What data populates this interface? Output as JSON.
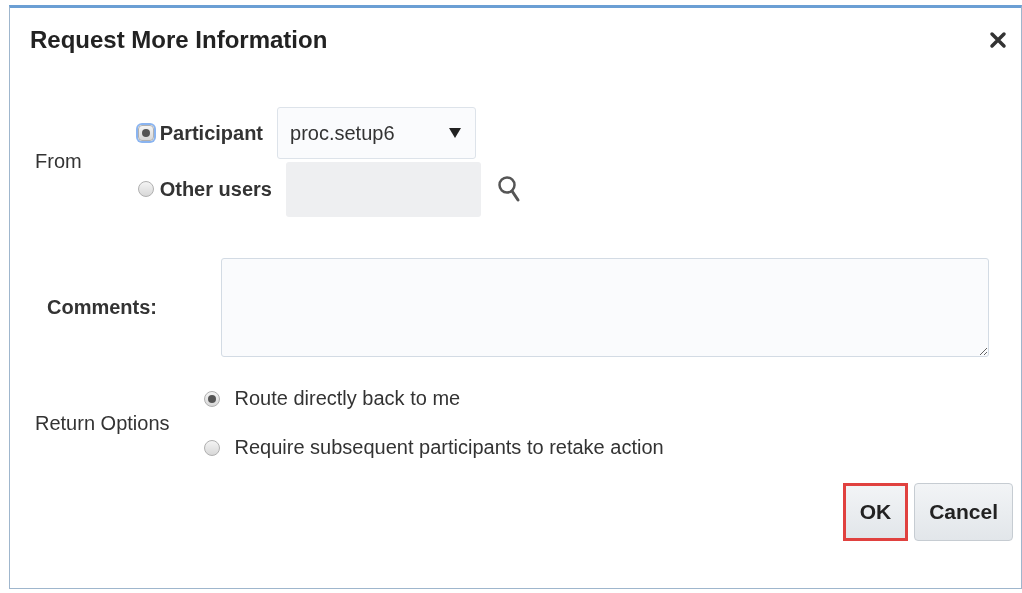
{
  "window": {
    "title": "Request More Information"
  },
  "from": {
    "label": "From",
    "options": [
      {
        "label": "Participant",
        "selected": true,
        "focused": true,
        "kind": "select",
        "value": "proc.setup6"
      },
      {
        "label": "Other users",
        "selected": false,
        "focused": false,
        "kind": "lookup"
      }
    ]
  },
  "comments": {
    "label": "Comments:"
  },
  "return_options": {
    "label": "Return Options",
    "options": [
      {
        "label": "Route directly back to me",
        "selected": true
      },
      {
        "label": "Require subsequent participants to retake action",
        "selected": false
      }
    ]
  },
  "buttons": [
    {
      "label": "OK",
      "highlighted": true
    },
    {
      "label": "Cancel",
      "highlighted": false
    }
  ]
}
